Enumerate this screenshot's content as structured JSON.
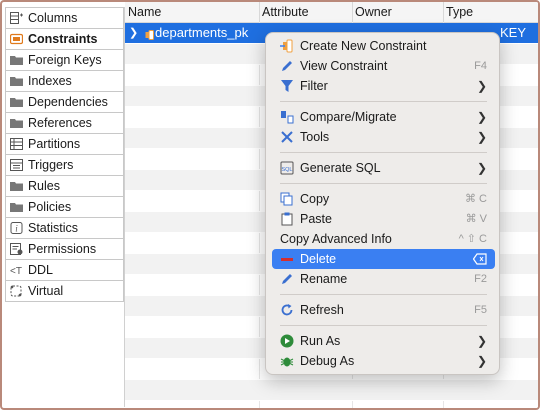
{
  "sidebar": {
    "items": [
      {
        "label": "Columns",
        "icon": "columns-icon"
      },
      {
        "label": "Constraints",
        "icon": "constraints-icon",
        "active": true
      },
      {
        "label": "Foreign Keys",
        "icon": "folder-icon"
      },
      {
        "label": "Indexes",
        "icon": "folder-icon"
      },
      {
        "label": "Dependencies",
        "icon": "folder-icon"
      },
      {
        "label": "References",
        "icon": "folder-icon"
      },
      {
        "label": "Partitions",
        "icon": "partitions-icon"
      },
      {
        "label": "Triggers",
        "icon": "triggers-icon"
      },
      {
        "label": "Rules",
        "icon": "folder-icon"
      },
      {
        "label": "Policies",
        "icon": "folder-icon"
      },
      {
        "label": "Statistics",
        "icon": "statistics-icon"
      },
      {
        "label": "Permissions",
        "icon": "permissions-icon"
      },
      {
        "label": "DDL",
        "icon": "ddl-icon"
      },
      {
        "label": "Virtual",
        "icon": "virtual-icon"
      }
    ]
  },
  "table": {
    "headers": [
      "Name",
      "Attribute",
      "Owner",
      "Type"
    ],
    "selected_row": {
      "name": "departments_pk",
      "type": "KEY"
    }
  },
  "menu": {
    "create": {
      "label": "Create New Constraint"
    },
    "view": {
      "label": "View Constraint",
      "shortcut": "F4"
    },
    "filter": {
      "label": "Filter"
    },
    "compare": {
      "label": "Compare/Migrate"
    },
    "tools": {
      "label": "Tools"
    },
    "generate_sql": {
      "label": "Generate SQL"
    },
    "copy": {
      "label": "Copy",
      "shortcut": "⌘ C"
    },
    "paste": {
      "label": "Paste",
      "shortcut": "⌘ V"
    },
    "copy_advanced": {
      "label": "Copy Advanced Info",
      "shortcut": "^ ⇧ C"
    },
    "delete": {
      "label": "Delete"
    },
    "rename": {
      "label": "Rename",
      "shortcut": "F2"
    },
    "refresh": {
      "label": "Refresh",
      "shortcut": "F5"
    },
    "run_as": {
      "label": "Run As"
    },
    "debug_as": {
      "label": "Debug As"
    }
  },
  "colors": {
    "selection": "#1f6fe0",
    "menu_highlight": "#3a7ff2",
    "frame_border": "#b9897a"
  }
}
